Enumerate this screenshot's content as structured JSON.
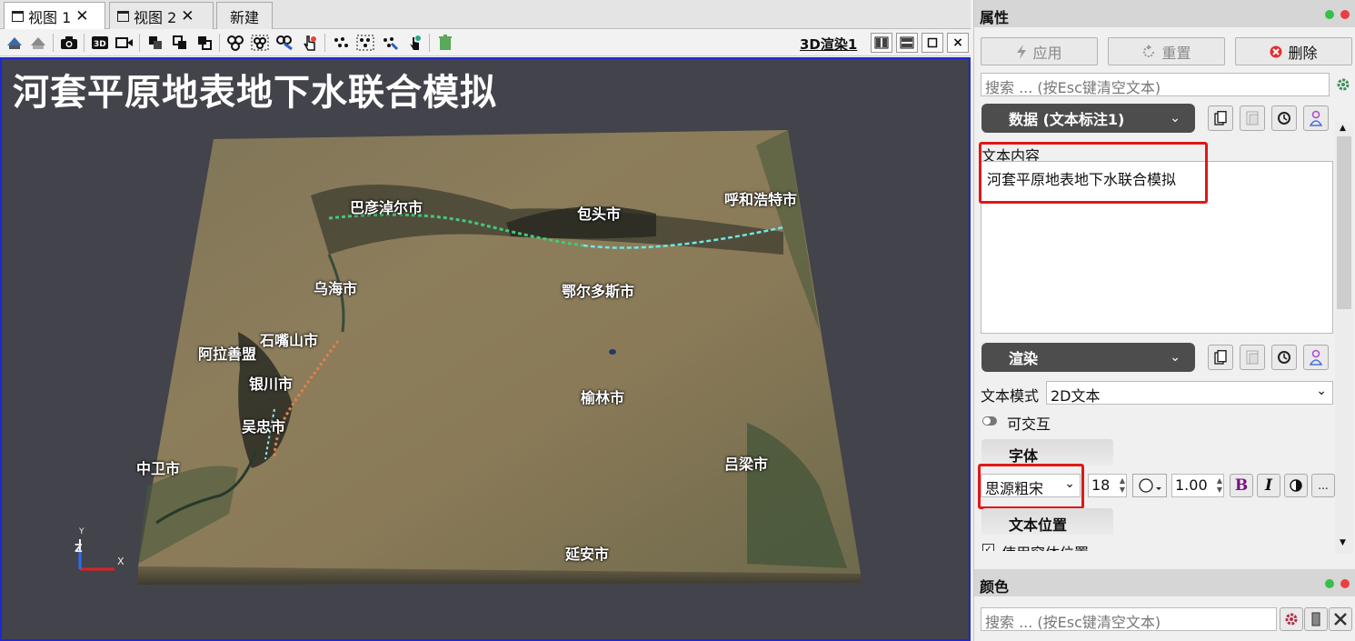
{
  "tabs": [
    {
      "label": "视图 1",
      "close": "✕"
    },
    {
      "label": "视图 2",
      "close": "✕"
    },
    {
      "label": "新建"
    }
  ],
  "toolbar": {
    "render_name": "3D渲染1"
  },
  "scene": {
    "title": "河套平原地表地下水联合模拟",
    "cities": [
      "巴彦淖尔市",
      "包头市",
      "呼和浩特市",
      "乌海市",
      "鄂尔多斯市",
      "石嘴山市",
      "阿拉善盟",
      "银川市",
      "榆林市",
      "吴忠市",
      "中卫市",
      "吕梁市",
      "延安市"
    ],
    "axes": {
      "x": "X",
      "y": "Y",
      "z": "Z"
    }
  },
  "props": {
    "header": "属性",
    "apply": "应用",
    "reset": "重置",
    "delete": "删除",
    "search_placeholder": "搜索 ... (按Esc键清空文本)",
    "data_section": "数据 (文本标注1)",
    "text_content_label": "文本内容",
    "text_content_value": "河套平原地表地下水联合模拟",
    "render_section": "渲染",
    "text_mode_label": "文本模式",
    "text_mode_value": "2D文本",
    "interactive_label": "可交互",
    "font_group": "字体",
    "font_family": "思源粗宋",
    "font_size": "18",
    "opacity": "1.00",
    "bold": "B",
    "italic": "I",
    "more": "...",
    "text_pos_group": "文本位置",
    "use_window_pos": "使用窗体位置"
  },
  "color_panel": {
    "header": "颜色",
    "search_placeholder": "搜索 ... (按Esc键清空文本)"
  }
}
